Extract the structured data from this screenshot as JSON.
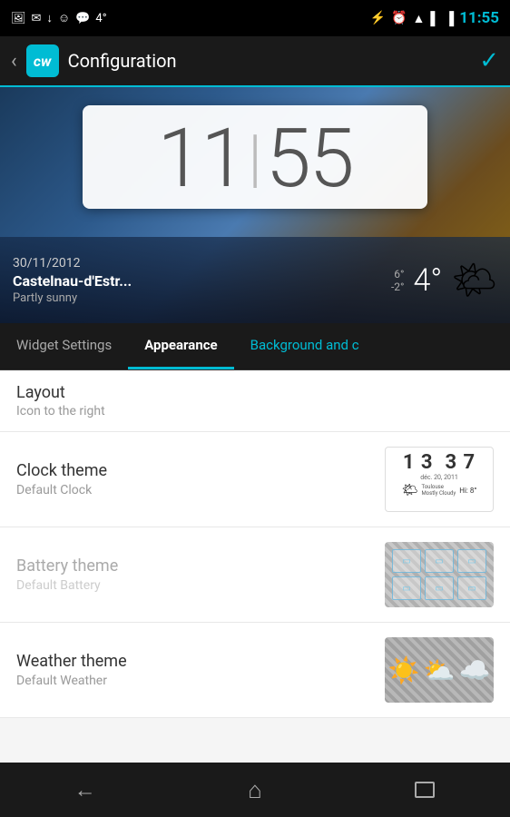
{
  "statusBar": {
    "time": "11:55",
    "temperature": "4°",
    "icons": [
      "image-icon",
      "email-icon",
      "download-icon",
      "emoji-icon",
      "talk-icon",
      "bluetooth-icon",
      "alarm-icon",
      "wifi-icon",
      "signal-icon",
      "battery-icon"
    ]
  },
  "actionBar": {
    "appIconText": "cw",
    "title": "Configuration",
    "backLabel": "‹",
    "checkLabel": "✓"
  },
  "preview": {
    "clockTime": {
      "h1": "1",
      "h2": "1",
      "sep": "|",
      "m1": "5",
      "m2": "5"
    },
    "weather": {
      "date": "30/11/2012",
      "city": "Castelnau-d'Estr...",
      "description": "Partly sunny",
      "tempHigh": "6°",
      "tempLow": "-2°",
      "tempMain": "4°"
    }
  },
  "tabs": [
    {
      "id": "widget-settings",
      "label": "Widget Settings",
      "active": false,
      "accent": false
    },
    {
      "id": "appearance",
      "label": "Appearance",
      "active": true,
      "accent": false
    },
    {
      "id": "background-and",
      "label": "Background and c",
      "active": false,
      "accent": true
    }
  ],
  "settings": {
    "layout": {
      "title": "Layout",
      "subtitle": "Icon to the right"
    },
    "clockTheme": {
      "title": "Clock theme",
      "subtitle": "Default Clock",
      "thumbTime": "1 3  3 7",
      "thumbDate": "déc. 20, 2011",
      "thumbCity": "Toulouse",
      "thumbWeather": "Mostly Cloudy",
      "thumbTemp": "Hi: 8°"
    },
    "batteryTheme": {
      "title": "Battery theme",
      "subtitle": "Default Battery",
      "disabled": true
    },
    "weatherTheme": {
      "title": "Weather theme",
      "subtitle": "Default Weather",
      "disabled": false
    }
  },
  "navBar": {
    "back": "back",
    "home": "home",
    "recents": "recents"
  }
}
